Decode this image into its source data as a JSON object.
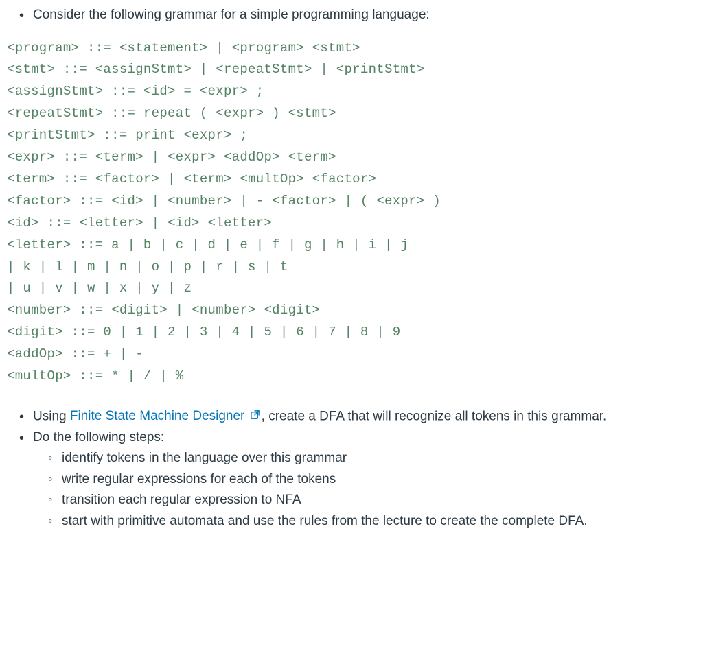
{
  "intro": {
    "text": "Consider the following grammar for a simple programming language:"
  },
  "grammar": {
    "lines": [
      "<program> ::= <statement> | <program> <stmt>",
      "<stmt> ::= <assignStmt> | <repeatStmt> | <printStmt>",
      "<assignStmt> ::= <id> = <expr> ;",
      "<repeatStmt> ::= repeat ( <expr> ) <stmt>",
      "<printStmt> ::= print <expr> ;",
      "<expr> ::= <term> | <expr> <addOp> <term>",
      "<term> ::= <factor> | <term> <multOp> <factor>",
      "<factor> ::= <id> | <number> | - <factor> | ( <expr> )",
      "<id> ::= <letter> | <id> <letter>",
      "<letter> ::= a | b | c | d | e | f | g | h | i | j",
      "| k | l | m | n | o | p | r | s | t",
      "| u | v | w | x | y | z",
      "<number> ::= <digit> | <number> <digit>",
      "<digit> ::= 0 | 1 | 2 | 3 | 4 | 5 | 6 | 7 | 8 | 9",
      "<addOp> ::= + | -",
      "<multOp> ::= * | / | %"
    ]
  },
  "instructions": {
    "item1_prefix": "Using ",
    "item1_link": "Finite State Machine Designer ",
    "item1_suffix": ", create a DFA that will recognize all tokens in this grammar.",
    "item2": "Do the following steps:",
    "sub": [
      "identify tokens in the language over this grammar",
      "write regular expressions for each of the tokens",
      "transition each regular expression to NFA",
      "start with primitive automata and use the rules from the lecture to create the complete DFA."
    ]
  }
}
